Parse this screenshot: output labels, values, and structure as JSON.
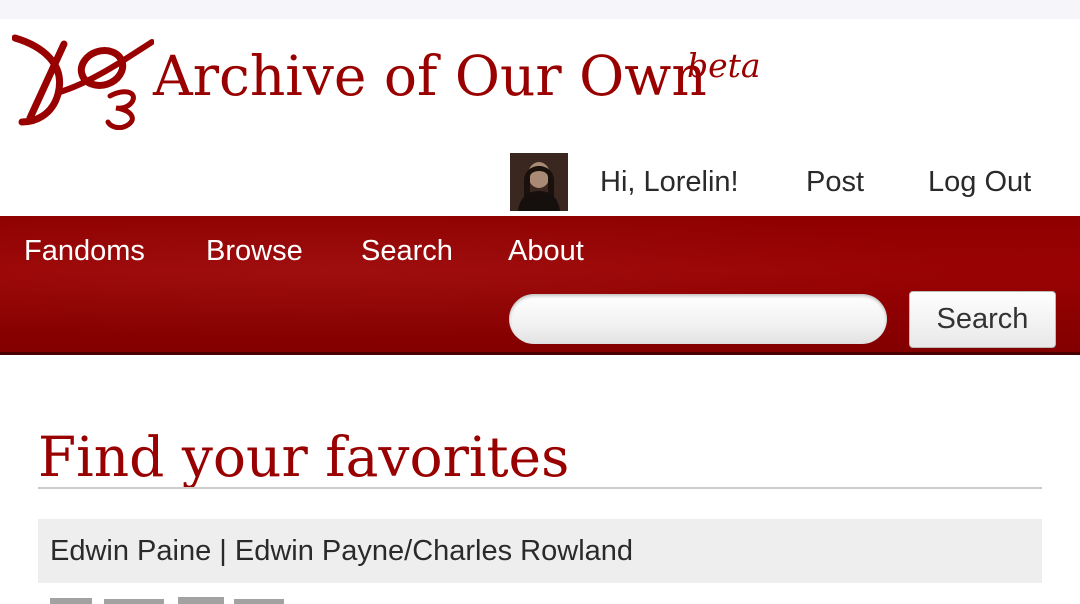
{
  "header": {
    "site_title": "Archive of Our Own",
    "beta_label": "beta",
    "logo_icon": "ao3-logo-icon"
  },
  "user_nav": {
    "avatar_icon": "user-avatar",
    "greeting": "Hi, Lorelin!",
    "post": "Post",
    "logout": "Log Out"
  },
  "main_nav": {
    "items": [
      "Fandoms",
      "Browse",
      "Search",
      "About"
    ]
  },
  "search": {
    "value": "",
    "placeholder": "",
    "button_label": "Search"
  },
  "main": {
    "heading": "Find your favorites",
    "favorites": [
      "Edwin Paine | Edwin Payne/Charles Rowland"
    ]
  },
  "colors": {
    "brand_red": "#990000",
    "nav_bar": "#900000",
    "highlight_bg": "#eeeeee"
  }
}
